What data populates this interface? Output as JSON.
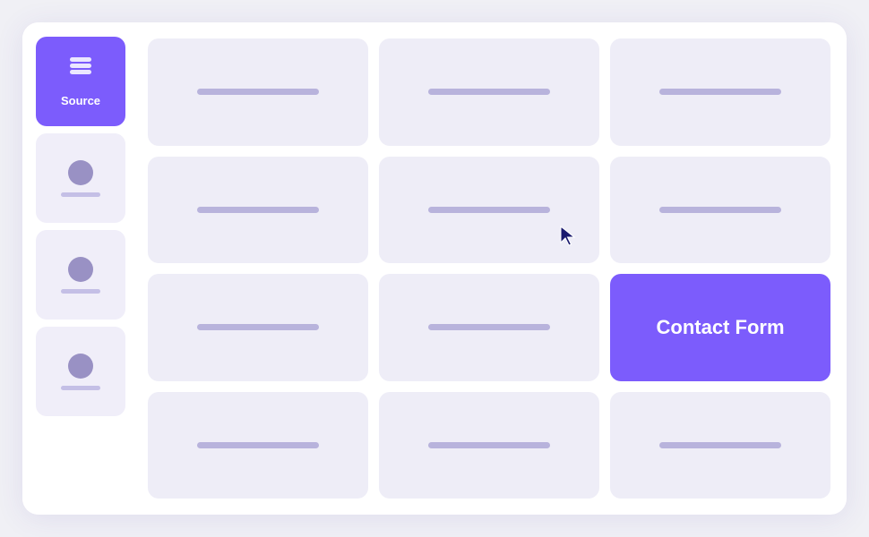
{
  "sidebar": {
    "items": [
      {
        "id": "source",
        "label": "Source",
        "active": true,
        "icon": "layers"
      },
      {
        "id": "user1",
        "label": "",
        "active": false,
        "icon": "person"
      },
      {
        "id": "user2",
        "label": "",
        "active": false,
        "icon": "person"
      },
      {
        "id": "user3",
        "label": "",
        "active": false,
        "icon": "person"
      }
    ]
  },
  "grid": {
    "rows": [
      [
        {
          "id": "r0c0",
          "highlighted": false
        },
        {
          "id": "r0c1",
          "highlighted": false
        },
        {
          "id": "r0c2",
          "highlighted": false
        }
      ],
      [
        {
          "id": "r1c0",
          "highlighted": false
        },
        {
          "id": "r1c1",
          "highlighted": false,
          "hasCursor": true
        },
        {
          "id": "r1c2",
          "highlighted": false
        }
      ],
      [
        {
          "id": "r2c0",
          "highlighted": false
        },
        {
          "id": "r2c1",
          "highlighted": false
        },
        {
          "id": "r2c2",
          "highlighted": true,
          "label": "Contact Form"
        }
      ],
      [
        {
          "id": "r3c0",
          "highlighted": false
        },
        {
          "id": "r3c1",
          "highlighted": false
        },
        {
          "id": "r3c2",
          "highlighted": false
        }
      ]
    ]
  },
  "colors": {
    "accent": "#7c5cfc",
    "cellBg": "#eeedf7",
    "cellBar": "#b8b3dc",
    "sidebarInactive": "#f0eef9"
  }
}
